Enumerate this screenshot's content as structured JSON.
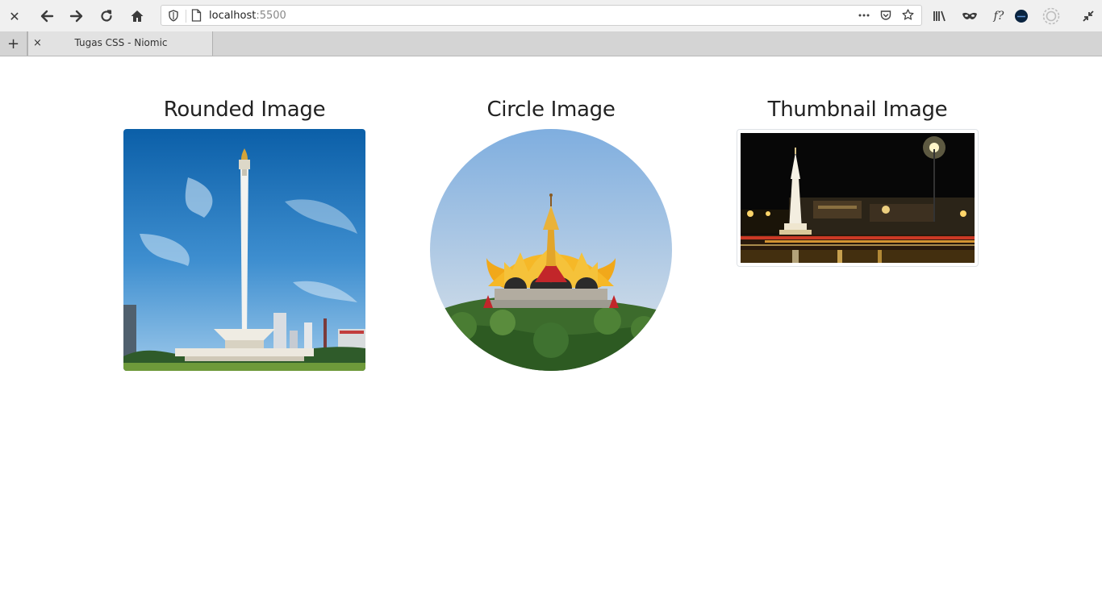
{
  "browser": {
    "url_host": "localhost",
    "url_port": ":5500",
    "tab_title": "Tugas CSS - Niomic",
    "new_tab_label": "+",
    "close_label": "×",
    "extension_label": "f?"
  },
  "page": {
    "col1_title": "Rounded Image",
    "col2_title": "Circle Image",
    "col3_title": "Thumbnail Image"
  },
  "colors": {
    "toolbar_bg": "#f0f0f0",
    "tabstrip_bg": "#d4d4d4",
    "page_bg": "#ffffff",
    "heading_text": "#222222"
  }
}
